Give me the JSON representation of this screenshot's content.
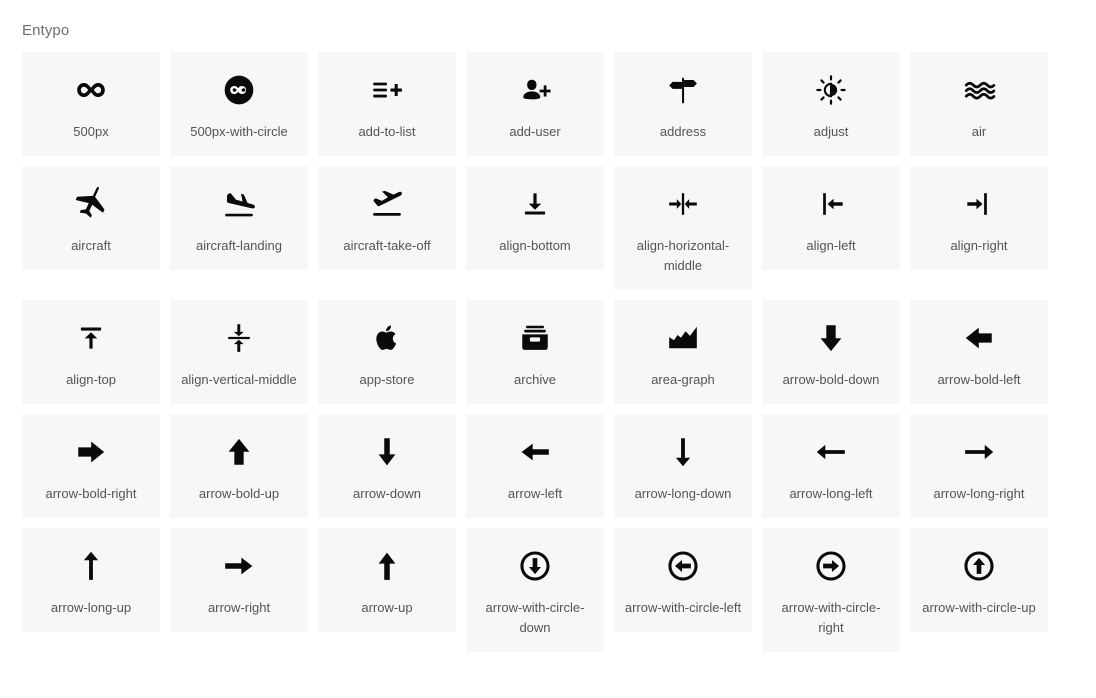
{
  "header": {
    "title": "Entypo"
  },
  "theme": {
    "page_background": "#ffffff",
    "card_background": "#f7f7f8",
    "icon_color": "#0a0a0a",
    "label_color": "#545454",
    "title_color": "#6e6e6e"
  },
  "grid": {
    "columns": 7,
    "icons": [
      {
        "label": "500px",
        "icon": "infinity-icon"
      },
      {
        "label": "500px-with-circle",
        "icon": "infinity-in-circle-icon"
      },
      {
        "label": "add-to-list",
        "icon": "list-plus-icon"
      },
      {
        "label": "add-user",
        "icon": "user-plus-icon"
      },
      {
        "label": "address",
        "icon": "signpost-icon"
      },
      {
        "label": "adjust",
        "icon": "brightness-contrast-icon"
      },
      {
        "label": "air",
        "icon": "wavy-lines-icon"
      },
      {
        "label": "aircraft",
        "icon": "airplane-icon"
      },
      {
        "label": "aircraft-landing",
        "icon": "airplane-landing-icon"
      },
      {
        "label": "aircraft-take-off",
        "icon": "airplane-takeoff-icon"
      },
      {
        "label": "align-bottom",
        "icon": "align-bottom-icon"
      },
      {
        "label": "align-horizontal-middle",
        "icon": "align-horizontal-middle-icon"
      },
      {
        "label": "align-left",
        "icon": "align-left-icon"
      },
      {
        "label": "align-right",
        "icon": "align-right-icon"
      },
      {
        "label": "align-top",
        "icon": "align-top-icon"
      },
      {
        "label": "align-vertical-middle",
        "icon": "align-vertical-middle-icon"
      },
      {
        "label": "app-store",
        "icon": "apple-icon"
      },
      {
        "label": "archive",
        "icon": "archive-box-icon"
      },
      {
        "label": "area-graph",
        "icon": "area-graph-icon"
      },
      {
        "label": "arrow-bold-down",
        "icon": "arrow-bold-down-icon"
      },
      {
        "label": "arrow-bold-left",
        "icon": "arrow-bold-left-icon"
      },
      {
        "label": "arrow-bold-right",
        "icon": "arrow-bold-right-icon"
      },
      {
        "label": "arrow-bold-up",
        "icon": "arrow-bold-up-icon"
      },
      {
        "label": "arrow-down",
        "icon": "arrow-down-icon"
      },
      {
        "label": "arrow-left",
        "icon": "arrow-left-icon"
      },
      {
        "label": "arrow-long-down",
        "icon": "arrow-long-down-icon"
      },
      {
        "label": "arrow-long-left",
        "icon": "arrow-long-left-icon"
      },
      {
        "label": "arrow-long-right",
        "icon": "arrow-long-right-icon"
      },
      {
        "label": "arrow-long-up",
        "icon": "arrow-long-up-icon"
      },
      {
        "label": "arrow-right",
        "icon": "arrow-right-icon"
      },
      {
        "label": "arrow-up",
        "icon": "arrow-up-icon"
      },
      {
        "label": "arrow-with-circle-down",
        "icon": "arrow-with-circle-down-icon"
      },
      {
        "label": "arrow-with-circle-left",
        "icon": "arrow-with-circle-left-icon"
      },
      {
        "label": "arrow-with-circle-right",
        "icon": "arrow-with-circle-right-icon"
      },
      {
        "label": "arrow-with-circle-up",
        "icon": "arrow-with-circle-up-icon"
      }
    ]
  }
}
